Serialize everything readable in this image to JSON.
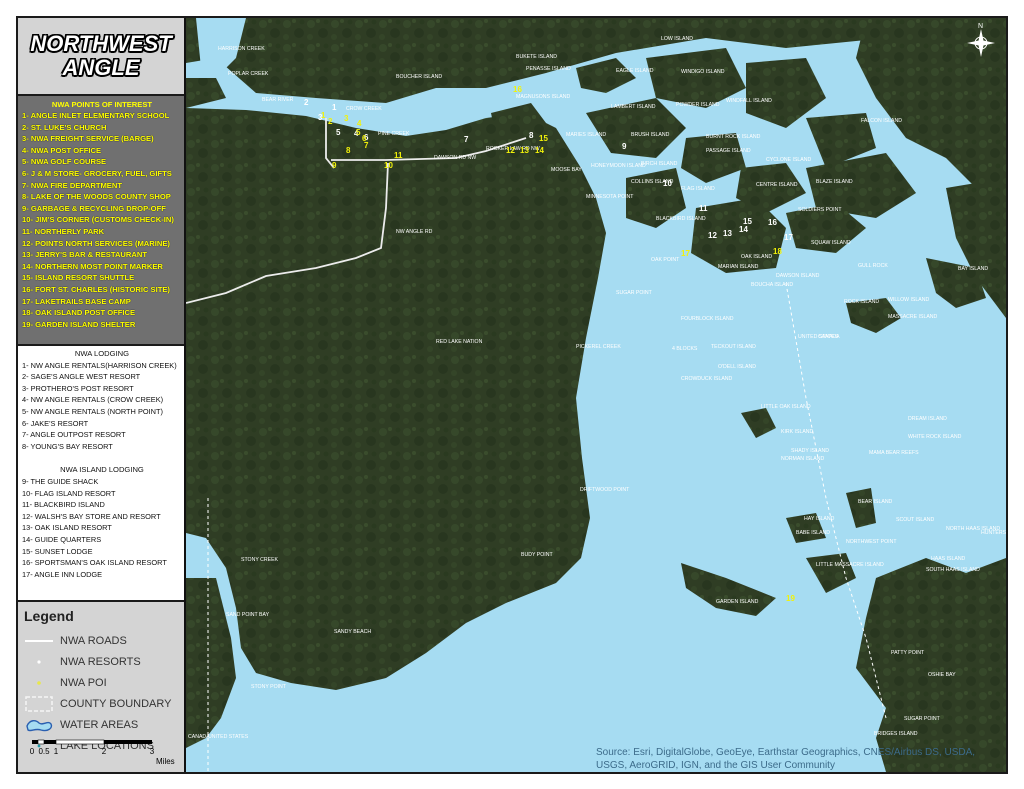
{
  "title": {
    "line1": "NORTHWEST",
    "line2": "ANGLE"
  },
  "poi": {
    "header": "NWA POINTS OF INTEREST",
    "items": [
      "1- ANGLE INLET ELEMENTARY SCHOOL",
      "2- ST. LUKE'S CHURCH",
      "3- NWA FREIGHT SERVICE (BARGE)",
      "4- NWA POST OFFICE",
      "5- NWA GOLF COURSE",
      "6- J & M STORE- GROCERY, FUEL, GIFTS",
      "7- NWA FIRE DEPARTMENT",
      "8- LAKE OF THE WOODS COUNTY SHOP",
      "9- GARBAGE & RECYCLING DROP-OFF",
      "10- JIM'S CORNER (CUSTOMS CHECK-IN)",
      "11- NORTHERLY PARK",
      "12- POINTS NORTH SERVICES (MARINE)",
      "13- JERRY'S BAR & RESTAURANT",
      "14- NORTHERN MOST POINT MARKER",
      "15- ISLAND RESORT SHUTTLE",
      "16- FORT ST. CHARLES (HISTORIC SITE)",
      "17- LAKETRAILS BASE CAMP",
      "18- OAK ISLAND POST OFFICE",
      "19- GARDEN ISLAND SHELTER"
    ]
  },
  "lodging": {
    "header": "NWA LODGING",
    "items": [
      "1- NW ANGLE RENTALS(HARRISON CREEK)",
      "2- SAGE'S ANGLE WEST RESORT",
      "3- PROTHERO'S POST RESORT",
      "4- NW ANGLE RENTALS (CROW CREEK)",
      "5- NW ANGLE RENTALS (NORTH POINT)",
      "6- JAKE'S RESORT",
      "7- ANGLE OUTPOST RESORT",
      "8- YOUNG'S BAY RESORT"
    ]
  },
  "island_lodging": {
    "header": "NWA ISLAND LODGING",
    "items": [
      "9- THE GUIDE SHACK",
      "10- FLAG ISLAND RESORT",
      "11- BLACKBIRD ISLAND",
      "12- WALSH'S BAY STORE AND RESORT",
      "13- OAK ISLAND RESORT",
      "14- GUIDE QUARTERS",
      "15- SUNSET LODGE",
      "16- SPORTSMAN'S OAK ISLAND RESORT",
      "17- ANGLE INN LODGE"
    ]
  },
  "legend": {
    "title": "Legend",
    "items": [
      "NWA ROADS",
      "NWA RESORTS",
      "NWA POI",
      "COUNTY BOUNDARY",
      "WATER AREAS",
      "LAKE LOCATIONS"
    ]
  },
  "scale": {
    "ticks": [
      "0",
      "0.5",
      "1",
      "2",
      "3"
    ],
    "unit": "Miles"
  },
  "colors": {
    "water": "#a6dcf2",
    "land": "#2e3c22",
    "poi": "#f2f20a",
    "resort": "#ffffff",
    "panel": "#d4d4d4"
  },
  "map": {
    "attribution_line1": "Source: Esri, DigitalGlobe, GeoEye, Earthstar Geographics, CNES/Airbus DS, USDA,",
    "attribution_line2": "USGS, AeroGRID, IGN, and the GIS User Community",
    "compass": "N",
    "place_labels": [
      "HARRISON CREEK",
      "POPLAR CREEK",
      "BEAR RIVER",
      "CROW CREEK",
      "PINE CREEK",
      "BOUCHER ISLAND",
      "BUKETE ISLAND",
      "PENASSE ISLAND",
      "MAGNUSONS ISLAND",
      "DAWSON RD NW",
      "MOOSE BAY",
      "MINNESOTA POINT",
      "LOW ISLAND",
      "EAGLE ISLAND",
      "WINDIGO ISLAND",
      "POWDER ISLAND",
      "WINDFALL ISLAND",
      "LAMBERT ISLAND",
      "MARIES ISLAND",
      "BRUSH ISLAND",
      "BURNT ROCK ISLAND",
      "PASSAGE ISLAND",
      "CYCLONE ISLAND",
      "FALCON ISLAND",
      "HONEYMOON ISLAND",
      "BIRCH ISLAND",
      "COLLINS ISLAND",
      "FLAG ISLAND",
      "CENTRE ISLAND",
      "BLAZE ISLAND",
      "SOLDIERS POINT",
      "BLACKBIRD ISLAND",
      "OAK ISLAND",
      "OAK POINT",
      "MARIAN ISLAND",
      "SQUAW ISLAND",
      "GULL ROCK",
      "BAY ISLAND",
      "DAWSON ISLAND",
      "BOUCHA ISLAND",
      "ROCK ISLAND",
      "WILLOW ISLAND",
      "MASSACRE ISLAND",
      "SUGAR POINT",
      "FOURBLOCK ISLAND",
      "4 BLOCKS",
      "TECKOUT ISLAND",
      "O'DELL ISLAND",
      "CROWDUCK ISLAND",
      "PICKEREL CREEK",
      "RED LAKE NATION",
      "LITTLE OAK ISLAND",
      "KIRK ISLAND",
      "SHADY ISLAND",
      "NORMAN ISLAND",
      "DREAM ISLAND",
      "WHITE ROCK ISLAND",
      "MAMA BEAR REEFS",
      "DRIFTWOOD POINT",
      "BEAR ISLAND",
      "HAY ISLAND",
      "BABE ISLAND",
      "SCOUT ISLAND",
      "NORTH HAAS ISLAND",
      "HUNTERS ISLAND",
      "NORTHWEST POINT",
      "HAAS ISLAND",
      "SOUTH HAAS ISLAND",
      "LITTLE MASSACRE ISLAND",
      "BUDY POINT",
      "GARDEN ISLAND",
      "STONY CREEK",
      "SAND POINT BAY",
      "SANDY BEACH",
      "STONY POINT",
      "PATTY POINT",
      "OSHIE BAY",
      "SUGAR POINT",
      "BRIDGES ISLAND",
      "CANADA",
      "UNITED STATES",
      "CANADA",
      "UNITED STATES",
      "NW ANGLE RD",
      "ROCKER LAW RD NW"
    ],
    "poi_markers": [
      "1",
      "2",
      "3",
      "4",
      "5",
      "6",
      "7",
      "8",
      "9",
      "10",
      "11",
      "12",
      "13",
      "14",
      "15",
      "16",
      "17",
      "18",
      "19"
    ],
    "resort_markers": [
      "1",
      "2",
      "3",
      "4",
      "5",
      "6",
      "7",
      "8",
      "9",
      "10",
      "11",
      "12",
      "13",
      "14",
      "15",
      "16",
      "17"
    ]
  }
}
